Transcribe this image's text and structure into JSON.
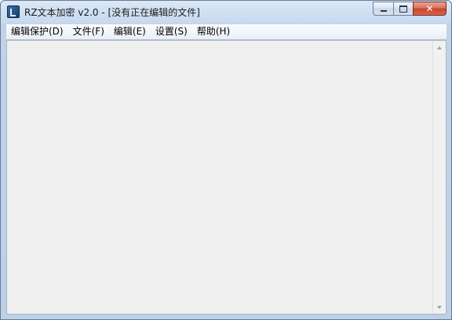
{
  "window": {
    "title": "RZ文本加密 v2.0 - [没有正在编辑的文件]"
  },
  "caption": {
    "close_glyph": "✕"
  },
  "menu": {
    "items": [
      {
        "label": "编辑保护(D)"
      },
      {
        "label": "文件(F)"
      },
      {
        "label": "编辑(E)"
      },
      {
        "label": "设置(S)"
      },
      {
        "label": "帮助(H)"
      }
    ]
  },
  "editor": {
    "content": ""
  },
  "colors": {
    "frame": "#bcd0e8",
    "client_background": "#f0f0f0",
    "close_button": "#c5432b"
  },
  "icons": {
    "app": "app-icon",
    "minimize": "minimize-icon",
    "maximize": "maximize-icon",
    "close": "close-icon",
    "scroll_up": "chevron-up-icon",
    "scroll_down": "chevron-down-icon"
  }
}
